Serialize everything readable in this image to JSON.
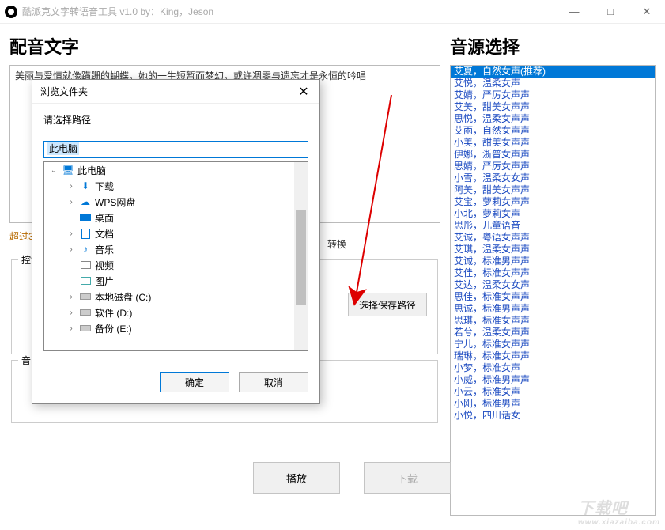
{
  "window": {
    "title": "酷派克文字转语音工具 v1.0 by：King，Jeson",
    "min": "—",
    "max": "□",
    "close": "✕"
  },
  "left": {
    "heading": "配音文字",
    "text_content": "美丽与爱情就像蹒跚的蝴蝶，她的一生短暂而梦幻，或许凋零与遗忘才是永恒的吟唱",
    "hint": "超过3",
    "control_label": "控制",
    "convert_label": "转换",
    "select_path_btn": "选择保存路径",
    "audio_label": "音",
    "play_btn": "播放",
    "download_btn": "下载"
  },
  "right": {
    "heading": "音源选择",
    "voices": [
      "艾夏，自然女声(推荐)",
      "艾悦，温柔女声",
      "艾婧，严厉女声声",
      "艾美，甜美女声声",
      "思悦，温柔女声声",
      "艾雨，自然女声声",
      "小美，甜美女声声",
      "伊娜，浙普女声声",
      "思婧，严厉女声声",
      "小雪，温柔女女声",
      "阿美，甜美女声声",
      "艾宝，萝莉女声声",
      "小北，萝莉女声",
      "思彤，儿童语音",
      "艾诚，粤语女声声",
      "艾琪，温柔女声声",
      "艾诚，标准男声声",
      "艾佳，标准女声声",
      "艾达，温柔女女声",
      "思佳，标准女声声",
      "思诚，标准男声声",
      "思琪，标准女声声",
      "若兮，温柔女声声",
      "宁儿，标准女声声",
      "瑞琳，标准女声声",
      "小梦，标准女声",
      "小威，标准男声声",
      "小云，标准女声",
      "小刚，标准男声",
      "小悦，四川话女"
    ],
    "selected_index": 0
  },
  "dialog": {
    "title": "浏览文件夹",
    "prompt": "请选择路径",
    "path_value": "此电脑",
    "tree": [
      {
        "chev": "v",
        "icon": "pc",
        "label": "此电脑",
        "indent": 0
      },
      {
        "chev": ">",
        "icon": "dl",
        "label": "下载",
        "indent": 1
      },
      {
        "chev": ">",
        "icon": "cloud",
        "label": "WPS网盘",
        "indent": 1
      },
      {
        "chev": "",
        "icon": "desk",
        "label": "桌面",
        "indent": 1
      },
      {
        "chev": ">",
        "icon": "doc",
        "label": "文档",
        "indent": 1
      },
      {
        "chev": ">",
        "icon": "music",
        "label": "音乐",
        "indent": 1
      },
      {
        "chev": "",
        "icon": "video",
        "label": "视频",
        "indent": 1
      },
      {
        "chev": "",
        "icon": "img",
        "label": "图片",
        "indent": 1
      },
      {
        "chev": ">",
        "icon": "disk",
        "label": "本地磁盘 (C:)",
        "indent": 1
      },
      {
        "chev": ">",
        "icon": "disk",
        "label": "软件 (D:)",
        "indent": 1
      },
      {
        "chev": ">",
        "icon": "disk",
        "label": "备份 (E:)",
        "indent": 1
      }
    ],
    "ok": "确定",
    "cancel": "取消"
  },
  "watermark": {
    "big": "下载吧",
    "small": "www.xiazaiba.com"
  }
}
